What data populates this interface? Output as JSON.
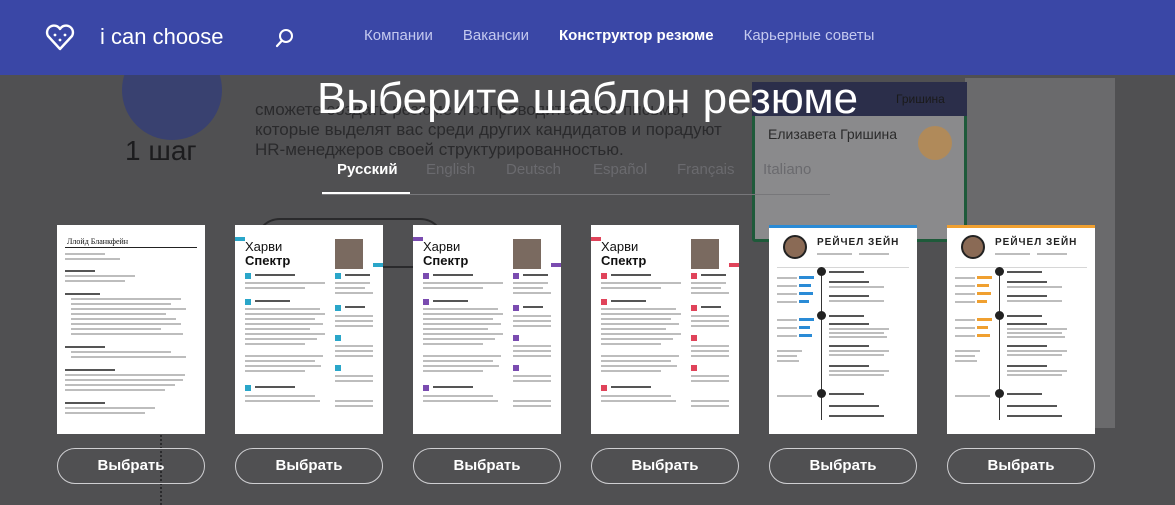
{
  "header": {
    "logo_text": "i can choose",
    "nav": [
      "Компании",
      "Вакансии",
      "Конструктор резюме",
      "Карьерные советы"
    ],
    "active_nav": 2
  },
  "background": {
    "step": "1 шаг",
    "paragraph": "сможете создать резюме и сопроводительное письмо, которые выделят вас среди других кандидатов и порадуют HR-менеджеров своей структурированностью.",
    "card_name": "Елизавета Гришина",
    "card_name2": "Гришина"
  },
  "title": "Выберите шаблон резюме",
  "tabs": [
    "Русский",
    "English",
    "Deutsch",
    "Español",
    "Français",
    "Italiano"
  ],
  "active_tab": 0,
  "templates": [
    {
      "name_first": "Ллойд Бланкфейн",
      "name_second": "",
      "accent": "#111111",
      "button": "Выбрать"
    },
    {
      "name_first": "Харви",
      "name_second": "Спектр",
      "accent": "#2aa6c9",
      "button": "Выбрать"
    },
    {
      "name_first": "Харви",
      "name_second": "Спектр",
      "accent": "#7a4bb0",
      "button": "Выбрать"
    },
    {
      "name_first": "Харви",
      "name_second": "Спектр",
      "accent": "#e0435a",
      "button": "Выбрать"
    },
    {
      "name_first": "РЕЙЧЕЛ ЗЕЙН",
      "name_second": "",
      "accent": "#2a8bd6",
      "button": "Выбрать"
    },
    {
      "name_first": "РЕЙЧЕЛ ЗЕЙН",
      "name_second": "",
      "accent": "#f0a030",
      "button": "Выбрать"
    }
  ],
  "colors": {
    "header": "#3a47a6",
    "overlay": "#505052"
  }
}
